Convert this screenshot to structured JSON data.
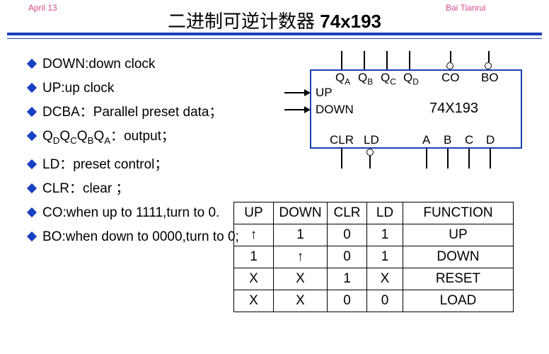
{
  "header": {
    "left_small": "April 13",
    "right_small": "Bai Tianrui",
    "title_cn": "二进制可逆计数器",
    "title_chip": "74x193"
  },
  "bullets": {
    "b1": "DOWN:down clock",
    "b2": "UP:up clock",
    "b3": "DCBA：Parallel preset data；",
    "b4_prefix": "Q",
    "b4_suffix": "：output；",
    "b5": "LD：preset control；",
    "b6": "CLR：clear ；",
    "b7": "CO:when up to 1111,turn to 0.",
    "b8": "BO:when down to 0000,turn to 0;"
  },
  "chip": {
    "name": "74X193",
    "up": "UP",
    "down": "DOWN",
    "qa": "Q",
    "qb": "Q",
    "qc": "Q",
    "qd": "Q",
    "co": "CO",
    "bo": "BO",
    "clr": "CLR",
    "ld": "LD",
    "a": "A",
    "b": "B",
    "c": "C",
    "d": "D",
    "subA": "A",
    "subB": "B",
    "subC": "C",
    "subD": "D"
  },
  "table": {
    "head": {
      "c1": "UP",
      "c2": "DOWN",
      "c3": "CLR",
      "c4": "LD",
      "c5": "FUNCTION"
    },
    "rows": [
      {
        "c1": "↑",
        "c2": "1",
        "c3": "0",
        "c4": "1",
        "c5": "UP"
      },
      {
        "c1": "1",
        "c2": "↑",
        "c3": "0",
        "c4": "1",
        "c5": "DOWN"
      },
      {
        "c1": "X",
        "c2": "X",
        "c3": "1",
        "c4": "X",
        "c5": "RESET"
      },
      {
        "c1": "X",
        "c2": "X",
        "c3": "0",
        "c4": "0",
        "c5": "LOAD"
      }
    ]
  }
}
